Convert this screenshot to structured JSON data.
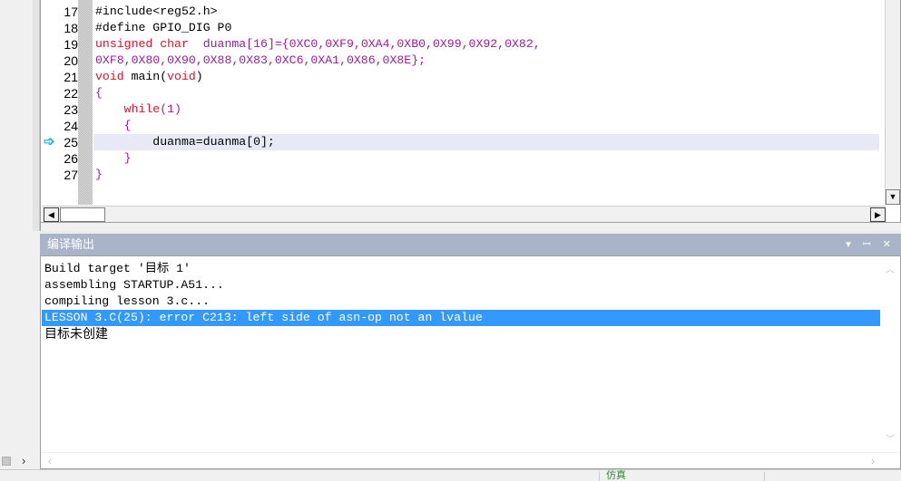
{
  "editor": {
    "current_line_marker": "➩",
    "lines": [
      {
        "num": "17",
        "segs": [
          {
            "t": "#include<reg52.h>",
            "c": ""
          }
        ]
      },
      {
        "num": "18",
        "segs": [
          {
            "t": "#define GPIO_DIG P0",
            "c": ""
          }
        ]
      },
      {
        "num": "19",
        "segs": [
          {
            "t": "unsigned char",
            "c": "kw"
          },
          {
            "t": "  duanma[16]={0XC0,0XF9,0XA4,0XB0,0X99,0X92,0X82,",
            "c": "mg"
          }
        ]
      },
      {
        "num": "20",
        "segs": [
          {
            "t": "0XF8,0X80,0X90,0X88,0X83,0XC6,0XA1,0X86,0X8E};",
            "c": "mg"
          }
        ]
      },
      {
        "num": "21",
        "segs": [
          {
            "t": "void",
            "c": "kw"
          },
          {
            "t": " main(",
            "c": ""
          },
          {
            "t": "void",
            "c": "kw"
          },
          {
            "t": ")",
            "c": ""
          }
        ]
      },
      {
        "num": "22",
        "segs": [
          {
            "t": "{",
            "c": "mg"
          }
        ]
      },
      {
        "num": "23",
        "segs": [
          {
            "t": "    ",
            "c": ""
          },
          {
            "t": "while",
            "c": "kw"
          },
          {
            "t": "(1)",
            "c": "mg"
          }
        ]
      },
      {
        "num": "24",
        "segs": [
          {
            "t": "    {",
            "c": "mg"
          }
        ]
      },
      {
        "num": "25",
        "segs": [
          {
            "t": "        duanma=duanma[0];",
            "c": ""
          }
        ]
      },
      {
        "num": "26",
        "segs": [
          {
            "t": "    }",
            "c": "mg"
          }
        ]
      },
      {
        "num": "27",
        "segs": [
          {
            "t": "}",
            "c": "mg"
          }
        ]
      }
    ]
  },
  "output": {
    "title": "编译输出",
    "controls": "▾ ꟷ ✕",
    "lines": [
      "Build target '目标 1'",
      "assembling STARTUP.A51...",
      "compiling lesson 3.c...",
      "LESSON 3.C(25): error C213: left side of asn-op not an lvalue",
      "目标未创建"
    ]
  },
  "statusbar": {
    "text": "仿真"
  },
  "icons": {
    "left": "◀",
    "right": "▶",
    "up": "▲",
    "down": "▼",
    "chevron_right": "›",
    "out_up": "︿",
    "out_down": "﹀",
    "out_left": "‹",
    "out_right": "›"
  },
  "colors": {
    "keyword": "#e0102a",
    "literal": "#9c1c9c",
    "current_line": "#e8e8f6",
    "selection": "#3399ff",
    "pane_title": "#aab4c8"
  }
}
